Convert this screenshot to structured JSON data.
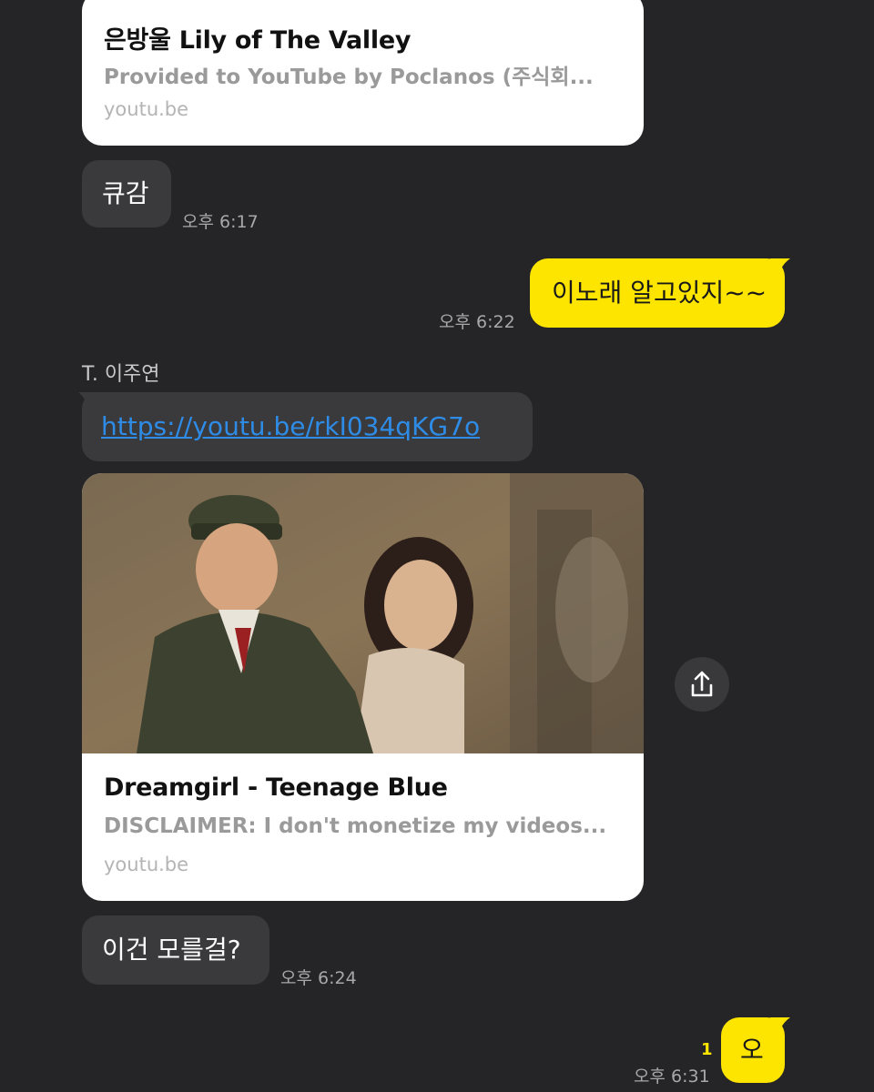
{
  "messages": {
    "card1": {
      "title": "은방울 Lily of The Valley",
      "description": "Provided to YouTube by Poclanos (주식회...",
      "domain": "youtu.be"
    },
    "msg_kyugam": {
      "text": "큐감",
      "time": "오후 6:17"
    },
    "msg_inorae": {
      "text": "이노래 알고있지~~",
      "time": "오후 6:22"
    },
    "sender_name": "T. 이주연",
    "msg_link": {
      "text": "https://youtu.be/rkI034qKG7o"
    },
    "card2": {
      "title": "Dreamgirl - Teenage Blue",
      "description": "DISCLAIMER: I don't monetize my videos...",
      "domain": "youtu.be",
      "thumbnail_icon": "video-thumbnail-image"
    },
    "share_icon": "share-icon",
    "msg_igeon": {
      "text": "이건 모를걸?",
      "time": "오후 6:24"
    },
    "msg_o": {
      "text": "오",
      "time": "오후 6:31",
      "unread_count": "1"
    }
  },
  "colors": {
    "background": "#252527",
    "incoming_bubble": "#3a3a3d",
    "outgoing_bubble": "#fee500",
    "link": "#2e8ce6",
    "unread": "#fee500"
  }
}
